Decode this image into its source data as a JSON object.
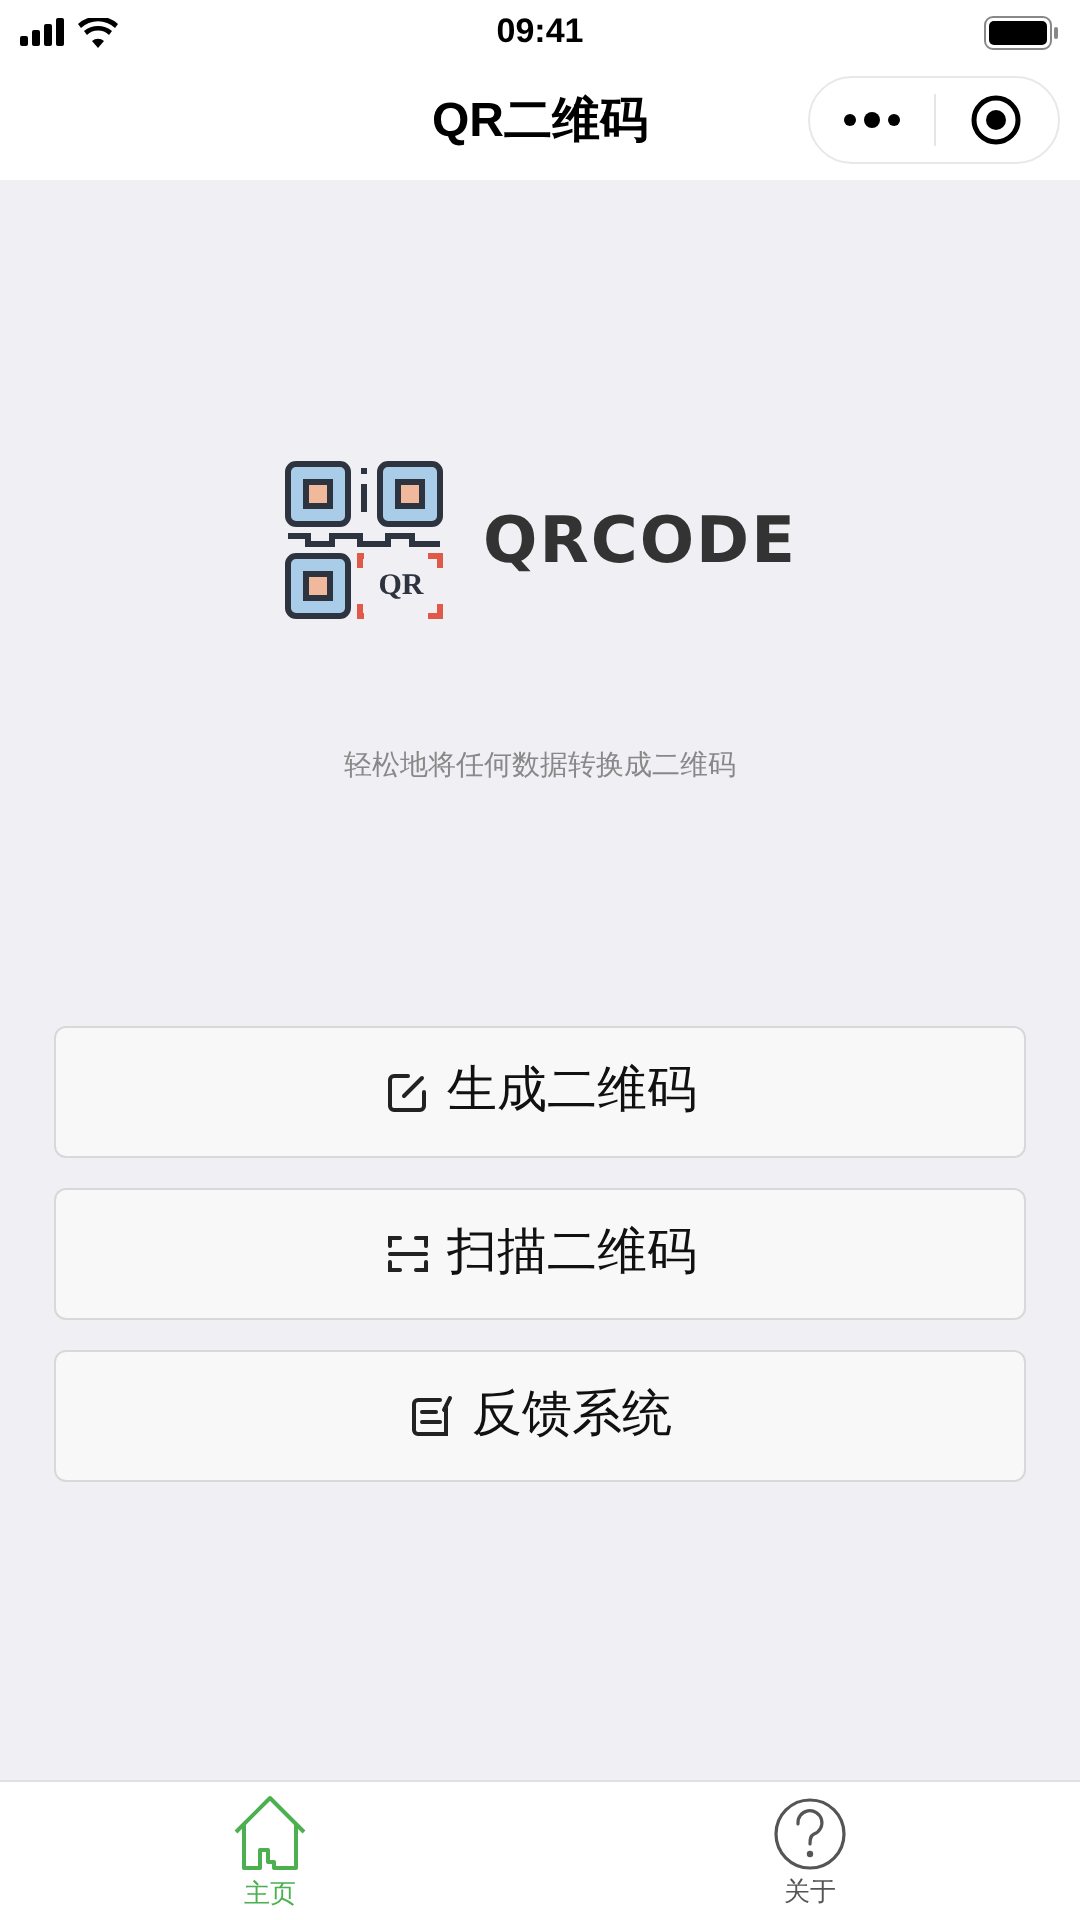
{
  "status_bar": {
    "time": "09:41"
  },
  "nav": {
    "title": "QR二维码"
  },
  "logo": {
    "badge": "QR",
    "wordmark": "QRCODE"
  },
  "tagline": "轻松地将任何数据转换成二维码",
  "actions": [
    {
      "kind": "create",
      "label": "生成二维码"
    },
    {
      "kind": "scan",
      "label": "扫描二维码"
    },
    {
      "kind": "feedback",
      "label": "反馈系统"
    }
  ],
  "tab_bar": [
    {
      "kind": "home",
      "label": "主页",
      "selected": true
    },
    {
      "kind": "about",
      "label": "关于",
      "selected": false
    }
  ]
}
